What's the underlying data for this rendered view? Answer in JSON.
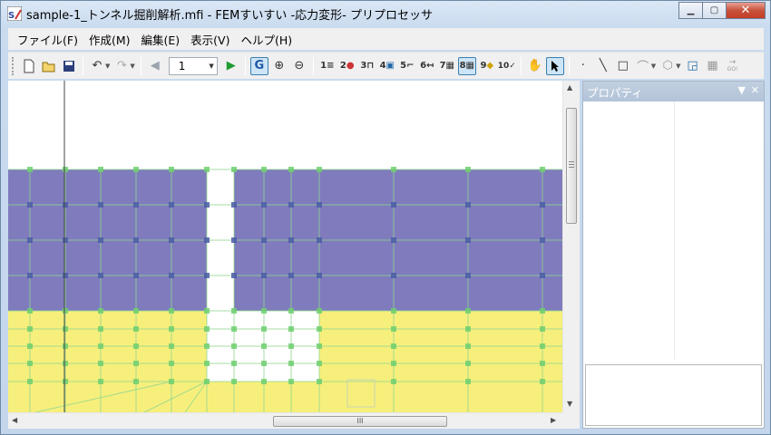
{
  "window": {
    "title": "sample-1_トンネル掘削解析.mfi - FEMすいすい -応力変形- プリプロセッサ",
    "minimize_icon": "minimize-icon",
    "maximize_icon": "maximize-icon",
    "close_icon": "close-icon"
  },
  "menu": {
    "items": [
      {
        "label": "ファイル(F)"
      },
      {
        "label": "作成(M)"
      },
      {
        "label": "編集(E)"
      },
      {
        "label": "表示(V)"
      },
      {
        "label": "ヘルプ(H)"
      }
    ]
  },
  "toolbar": {
    "page_value": "1",
    "icons": [
      "new-file-icon",
      "open-folder-icon",
      "save-icon",
      "undo-icon",
      "redo-icon",
      "previous-icon",
      "play-icon",
      "grid-snap-icon",
      "zoom-in-icon",
      "zoom-out-icon",
      "step-1-icon",
      "step-2-icon",
      "step-3-icon",
      "step-4-icon",
      "step-5-icon",
      "step-6-icon",
      "step-7-icon",
      "step-8-icon",
      "step-9-icon",
      "step-10-icon",
      "pan-hand-icon",
      "select-arrow-icon",
      "point-icon",
      "line-icon",
      "rectangle-icon",
      "arc-icon",
      "polygon-icon",
      "transform-icon",
      "mesh-icon",
      "go-icon"
    ],
    "step_labels": [
      "1",
      "2",
      "3",
      "4",
      "5",
      "6",
      "7",
      "8",
      "9",
      "10"
    ],
    "go_label": "GO!",
    "grid_label": "G"
  },
  "properties": {
    "title": "プロパティ"
  },
  "scrollbar": {
    "grip": "III"
  },
  "colors": {
    "upper_layer": "#7f7bbd",
    "lower_layer": "#f7ef7c",
    "mesh_node": "#6fcf6f",
    "mesh_line": "#8fd68f"
  }
}
